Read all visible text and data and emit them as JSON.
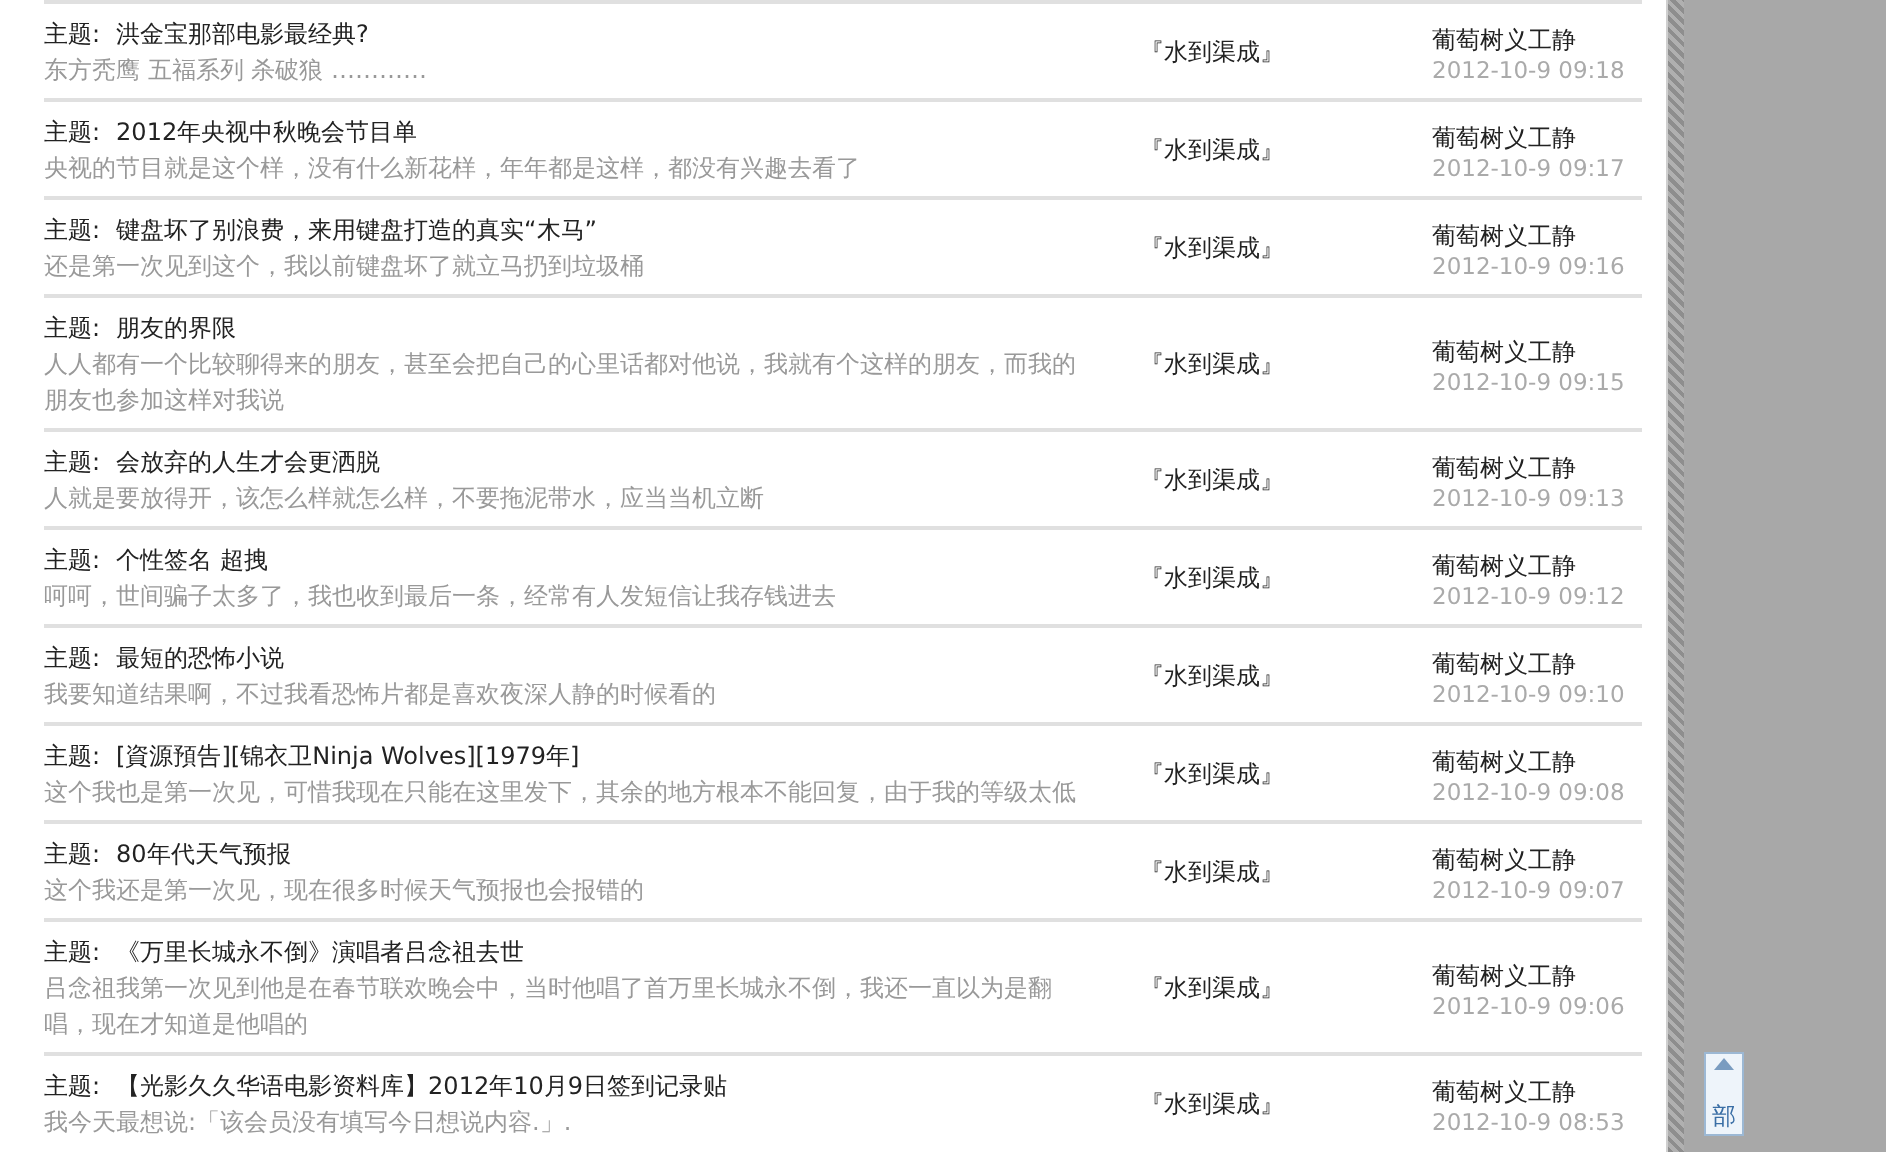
{
  "threads": [
    {
      "label": "主题:",
      "title": "洪金宝那部电影最经典?",
      "excerpt": "东方秃鹰 五福系列 杀破狼 …………",
      "forum": "『水到渠成』",
      "author": "葡萄树义工静",
      "time": "2012-10-9 09:18"
    },
    {
      "label": "主题:",
      "title": "2012年央视中秋晚会节目单",
      "excerpt": "央视的节目就是这个样，没有什么新花样，年年都是这样，都没有兴趣去看了",
      "forum": "『水到渠成』",
      "author": "葡萄树义工静",
      "time": "2012-10-9 09:17"
    },
    {
      "label": "主题:",
      "title": "键盘坏了别浪费，来用键盘打造的真实“木马”",
      "excerpt": "还是第一次见到这个，我以前键盘坏了就立马扔到垃圾桶",
      "forum": "『水到渠成』",
      "author": "葡萄树义工静",
      "time": "2012-10-9 09:16"
    },
    {
      "label": "主题:",
      "title": "朋友的界限",
      "excerpt": "人人都有一个比较聊得来的朋友，甚至会把自己的心里话都对他说，我就有个这样的朋友，而我的朋友也参加这样对我说",
      "forum": "『水到渠成』",
      "author": "葡萄树义工静",
      "time": "2012-10-9 09:15"
    },
    {
      "label": "主题:",
      "title": "会放弃的人生才会更洒脱",
      "excerpt": "人就是要放得开，该怎么样就怎么样，不要拖泥带水，应当当机立断",
      "forum": "『水到渠成』",
      "author": "葡萄树义工静",
      "time": "2012-10-9 09:13"
    },
    {
      "label": "主题:",
      "title": "个性签名 超拽",
      "excerpt": "呵呵，世间骗子太多了，我也收到最后一条，经常有人发短信让我存钱进去",
      "forum": "『水到渠成』",
      "author": "葡萄树义工静",
      "time": "2012-10-9 09:12"
    },
    {
      "label": "主题:",
      "title": "最短的恐怖小说",
      "excerpt": "我要知道结果啊，不过我看恐怖片都是喜欢夜深人静的时候看的",
      "forum": "『水到渠成』",
      "author": "葡萄树义工静",
      "time": "2012-10-9 09:10"
    },
    {
      "label": "主题:",
      "title": "[資源預告][锦衣卫Ninja Wolves][1979年]",
      "excerpt": "这个我也是第一次见，可惜我现在只能在这里发下，其余的地方根本不能回复，由于我的等级太低",
      "forum": "『水到渠成』",
      "author": "葡萄树义工静",
      "time": "2012-10-9 09:08"
    },
    {
      "label": "主题:",
      "title": "80年代天气预报",
      "excerpt": "这个我还是第一次见，现在很多时候天气预报也会报错的",
      "forum": "『水到渠成』",
      "author": "葡萄树义工静",
      "time": "2012-10-9 09:07"
    },
    {
      "label": "主题:",
      "title": "《万里长城永不倒》演唱者吕念祖去世",
      "excerpt": "吕念祖我第一次见到他是在春节联欢晚会中，当时他唱了首万里长城永不倒，我还一直以为是翻唱，现在才知道是他唱的",
      "forum": "『水到渠成』",
      "author": "葡萄树义工静",
      "time": "2012-10-9 09:06"
    },
    {
      "label": "主题:",
      "title": "【光影久久华语电影资料库】2012年10月9日签到记录贴",
      "excerpt": "我今天最想说:「该会员没有填写今日想说内容.」.",
      "forum": "『水到渠成』",
      "author": "葡萄树义工静",
      "time": "2012-10-9 08:53"
    }
  ],
  "back_to_top": {
    "label": "部"
  }
}
